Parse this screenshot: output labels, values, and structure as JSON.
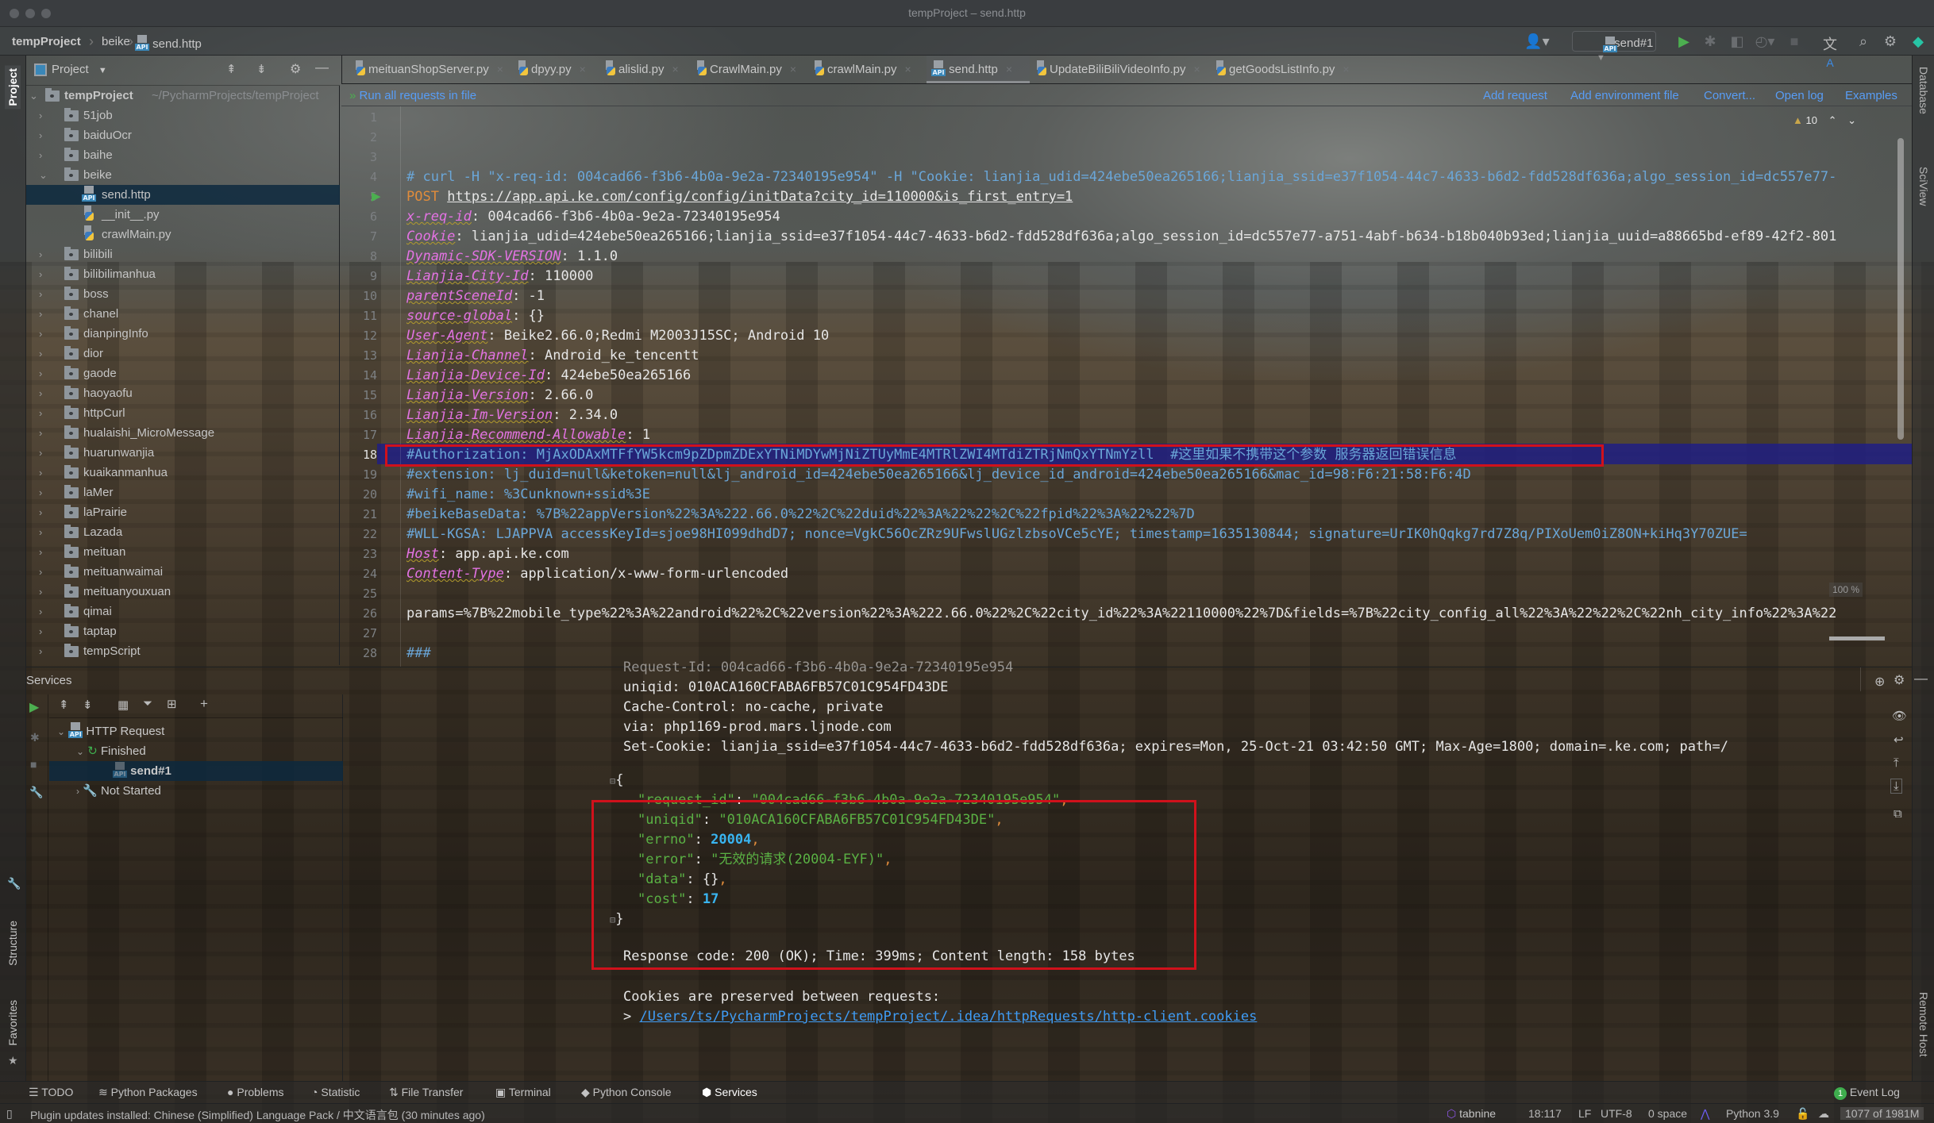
{
  "window": {
    "title": "tempProject – send.http"
  },
  "breadcrumb": {
    "items": [
      "tempProject",
      "beike",
      "send.http"
    ]
  },
  "toolbar": {
    "run_config": "send#1",
    "icons": [
      "vcs-user-icon",
      "run-icon",
      "debug-icon",
      "coverage-icon",
      "profile-icon",
      "stop-icon",
      "translate-icon",
      "search-icon",
      "settings-icon",
      "toolbox-icon"
    ]
  },
  "project_panel": {
    "title": "Project",
    "root": {
      "name": "tempProject",
      "path": "~/PycharmProjects/tempProject"
    },
    "items": [
      {
        "name": "51job",
        "type": "folder",
        "expanded": false
      },
      {
        "name": "baiduOcr",
        "type": "folder",
        "expanded": false
      },
      {
        "name": "baihe",
        "type": "folder",
        "expanded": false
      },
      {
        "name": "beike",
        "type": "folder",
        "expanded": true
      },
      {
        "name": "send.http",
        "type": "http",
        "child": true,
        "selected": true
      },
      {
        "name": "__init__.py",
        "type": "py",
        "child": true
      },
      {
        "name": "crawlMain.py",
        "type": "py",
        "child": true
      },
      {
        "name": "bilibili",
        "type": "folder"
      },
      {
        "name": "bilibilimanhua",
        "type": "folder"
      },
      {
        "name": "boss",
        "type": "folder"
      },
      {
        "name": "chanel",
        "type": "folder"
      },
      {
        "name": "dianpingInfo",
        "type": "folder"
      },
      {
        "name": "dior",
        "type": "folder"
      },
      {
        "name": "gaode",
        "type": "folder"
      },
      {
        "name": "haoyaofu",
        "type": "folder"
      },
      {
        "name": "httpCurl",
        "type": "folder"
      },
      {
        "name": "hualaishi_MicroMessage",
        "type": "folder"
      },
      {
        "name": "huarunwanjia",
        "type": "folder"
      },
      {
        "name": "kuaikanmanhua",
        "type": "folder"
      },
      {
        "name": "laMer",
        "type": "folder"
      },
      {
        "name": "laPrairie",
        "type": "folder"
      },
      {
        "name": "Lazada",
        "type": "folder"
      },
      {
        "name": "meituan",
        "type": "folder"
      },
      {
        "name": "meituanwaimai",
        "type": "folder"
      },
      {
        "name": "meituanyouxuan",
        "type": "folder"
      },
      {
        "name": "qimai",
        "type": "folder"
      },
      {
        "name": "taptap",
        "type": "folder"
      },
      {
        "name": "tempScript",
        "type": "folder"
      }
    ]
  },
  "tabs": [
    {
      "label": "meituanShopServer.py",
      "type": "py"
    },
    {
      "label": "dpyy.py",
      "type": "py"
    },
    {
      "label": "alislid.py",
      "type": "py"
    },
    {
      "label": "CrawlMain.py",
      "type": "py"
    },
    {
      "label": "crawlMain.py",
      "type": "py"
    },
    {
      "label": "send.http",
      "type": "http",
      "active": true
    },
    {
      "label": "UpdateBiliBiliVideoInfo.py",
      "type": "py"
    },
    {
      "label": "getGoodsListInfo.py",
      "type": "py"
    }
  ],
  "http_toolbar": {
    "run_all": "Run all requests in file",
    "links": [
      "Add request",
      "Add environment file",
      "Convert...",
      "Open log",
      "Examples"
    ]
  },
  "inspections": {
    "warnings": "10"
  },
  "editor": {
    "current_line": 18,
    "lines": [
      {
        "n": 1,
        "parts": []
      },
      {
        "n": 2,
        "parts": []
      },
      {
        "n": 3,
        "parts": []
      },
      {
        "n": 4,
        "parts": [
          {
            "c": "cm",
            "t": "# curl -H \"x-req-id: 004cad66-f3b6-4b0a-9e2a-72340195e954\" -H \"Cookie: lianjia_udid=424ebe50ea265166;lianjia_ssid=e37f1054-44c7-4633-b6d2-fdd528df636a;algo_session_id=dc557e77-"
          }
        ]
      },
      {
        "n": 5,
        "parts": [
          {
            "c": "post",
            "t": "POST"
          },
          {
            "c": "",
            "t": " "
          },
          {
            "c": "url",
            "t": "https://app.api.ke.com/config/config/initData?city_id=110000&is_first_entry=1"
          }
        ]
      },
      {
        "n": 6,
        "parts": [
          {
            "c": "k",
            "t": "x-req-id"
          },
          {
            "c": "",
            "t": ": 004cad66-f3b6-4b0a-9e2a-72340195e954"
          }
        ]
      },
      {
        "n": 7,
        "parts": [
          {
            "c": "k",
            "t": "Cookie"
          },
          {
            "c": "",
            "t": ": lianjia_udid=424ebe50ea265166;lianjia_ssid=e37f1054-44c7-4633-b6d2-fdd528df636a;algo_session_id=dc557e77-a751-4abf-b634-b18b040b93ed;lianjia_uuid=a88665bd-ef89-42f2-801"
          }
        ]
      },
      {
        "n": 8,
        "parts": [
          {
            "c": "k",
            "t": "Dynamic-SDK-VERSION"
          },
          {
            "c": "",
            "t": ": 1.1.0"
          }
        ]
      },
      {
        "n": 9,
        "parts": [
          {
            "c": "k",
            "t": "Lianjia-City-Id"
          },
          {
            "c": "",
            "t": ": 110000"
          }
        ]
      },
      {
        "n": 10,
        "parts": [
          {
            "c": "k",
            "t": "parentSceneId"
          },
          {
            "c": "",
            "t": ": -1"
          }
        ]
      },
      {
        "n": 11,
        "parts": [
          {
            "c": "k",
            "t": "source-global"
          },
          {
            "c": "",
            "t": ": {}"
          }
        ]
      },
      {
        "n": 12,
        "parts": [
          {
            "c": "k",
            "t": "User-Agent"
          },
          {
            "c": "",
            "t": ": Beike2.66.0;Redmi M2003J15SC; Android 10"
          }
        ]
      },
      {
        "n": 13,
        "parts": [
          {
            "c": "k",
            "t": "Lianjia-Channel"
          },
          {
            "c": "",
            "t": ": Android_ke_tencentt"
          }
        ]
      },
      {
        "n": 14,
        "parts": [
          {
            "c": "k",
            "t": "Lianjia-Device-Id"
          },
          {
            "c": "",
            "t": ": 424ebe50ea265166"
          }
        ]
      },
      {
        "n": 15,
        "parts": [
          {
            "c": "k",
            "t": "Lianjia-Version"
          },
          {
            "c": "",
            "t": ": 2.66.0"
          }
        ]
      },
      {
        "n": 16,
        "parts": [
          {
            "c": "k",
            "t": "Lianjia-Im-Version"
          },
          {
            "c": "",
            "t": ": 2.34.0"
          }
        ]
      },
      {
        "n": 17,
        "parts": [
          {
            "c": "k",
            "t": "Lianjia-Recommend-Allowable"
          },
          {
            "c": "",
            "t": ": 1"
          }
        ]
      },
      {
        "n": 18,
        "parts": [
          {
            "c": "cm",
            "t": "#Authorization: MjAxODAxMTFfYW5kcm9pZDpmZDExYTNiMDYwMjNiZTUyMmE4MTRlZWI4MTdiZTRjNmQxYTNmYzll  #这里如果不携带这个参数 服务器返回错误信息"
          }
        ]
      },
      {
        "n": 19,
        "parts": [
          {
            "c": "cm",
            "t": "#extension: lj_duid=null&ketoken=null&lj_android_id=424ebe50ea265166&lj_device_id_android=424ebe50ea265166&mac_id=98:F6:21:58:F6:4D"
          }
        ]
      },
      {
        "n": 20,
        "parts": [
          {
            "c": "cm",
            "t": "#wifi_name: %3Cunknown+ssid%3E"
          }
        ]
      },
      {
        "n": 21,
        "parts": [
          {
            "c": "cm",
            "t": "#beikeBaseData: %7B%22appVersion%22%3A%222.66.0%22%2C%22duid%22%3A%22%22%2C%22fpid%22%3A%22%22%7D"
          }
        ]
      },
      {
        "n": 22,
        "parts": [
          {
            "c": "cm",
            "t": "#WLL-KGSA: LJAPPVA accessKeyId=sjoe98HI099dhdD7; nonce=VgkC56OcZRz9UFwslUGzlzbsoVCe5cYE; timestamp=1635130844; signature=UrIK0hQqkg7rd7Z8q/PIXoUem0iZ8ON+kiHq3Y70ZUE="
          }
        ]
      },
      {
        "n": 23,
        "parts": [
          {
            "c": "k",
            "t": "Host"
          },
          {
            "c": "",
            "t": ": app.api.ke.com"
          }
        ]
      },
      {
        "n": 24,
        "parts": [
          {
            "c": "k",
            "t": "Content-Type"
          },
          {
            "c": "",
            "t": ": application/x-www-form-urlencoded"
          }
        ]
      },
      {
        "n": 25,
        "parts": []
      },
      {
        "n": 26,
        "parts": [
          {
            "c": "",
            "t": "params=%7B%22mobile_type%22%3A%22android%22%2C%22version%22%3A%222.66.0%22%2C%22city_id%22%3A%22110000%22%7D&fields=%7B%22city_config_all%22%3A%22%22%2C%22nh_city_info%22%3A%22"
          }
        ]
      },
      {
        "n": 27,
        "parts": []
      },
      {
        "n": 28,
        "parts": [
          {
            "c": "cm",
            "t": "###"
          }
        ]
      }
    ],
    "zoom_label": "100 %"
  },
  "services": {
    "title": "Services",
    "tree": [
      {
        "label": "HTTP Request",
        "level": 0,
        "icon": "api-icon",
        "expanded": true
      },
      {
        "label": "Finished",
        "level": 1,
        "icon": "finished-icon",
        "expanded": true
      },
      {
        "label": "send#1",
        "level": 2,
        "icon": "api-icon",
        "selected": true
      },
      {
        "label": "Not Started",
        "level": 1,
        "icon": "wrench-icon",
        "expanded": false
      }
    ],
    "output": {
      "headers": [
        "Request-Id: 004cad66-f3b6-4b0a-9e2a-72340195e954",
        "uniqid: 010ACA160CFABA6FB57C01C954FD43DE",
        "Cache-Control: no-cache, private",
        "via: php1169-prod.mars.ljnode.com",
        "Set-Cookie: lianjia_ssid=e37f1054-44c7-4633-b6d2-fdd528df636a; expires=Mon, 25-Oct-21 03:42:50 GMT; Max-Age=1800; domain=.ke.com; path=/"
      ],
      "json": [
        {
          "key": "\"request_id\"",
          "val": "\"004cad66-f3b6-4b0a-9e2a-72340195e954\"",
          "type": "str",
          "comma": true
        },
        {
          "key": "\"uniqid\"",
          "val": "\"010ACA160CFABA6FB57C01C954FD43DE\"",
          "type": "str",
          "comma": true
        },
        {
          "key": "\"errno\"",
          "val": "20004",
          "type": "num",
          "comma": true
        },
        {
          "key": "\"error\"",
          "val": "\"无效的请求(20004-EYF)\"",
          "type": "str",
          "comma": true
        },
        {
          "key": "\"data\"",
          "val": "{}",
          "type": "obj",
          "comma": true
        },
        {
          "key": "\"cost\"",
          "val": "17",
          "type": "num",
          "comma": false
        }
      ],
      "summary": "Response code: 200 (OK); Time: 399ms; Content length: 158 bytes",
      "cookies_note": "Cookies are preserved between requests:",
      "cookies_path": "/Users/ts/PycharmProjects/tempProject/.idea/httpRequests/http-client.cookies"
    }
  },
  "left_stripe": {
    "top": "Project",
    "bottom": [
      "Structure",
      "Favorites"
    ]
  },
  "right_stripe": {
    "top": [
      "Database",
      "SciView"
    ],
    "bottom": "Remote Host"
  },
  "tool_windows": [
    {
      "label": "TODO",
      "icon": "list-icon"
    },
    {
      "label": "Python Packages",
      "icon": "layers-icon"
    },
    {
      "label": "Problems",
      "icon": "problems-icon"
    },
    {
      "label": "Statistic",
      "icon": "statistic-icon"
    },
    {
      "label": "File Transfer",
      "icon": "transfer-icon"
    },
    {
      "label": "Terminal",
      "icon": "terminal-icon"
    },
    {
      "label": "Python Console",
      "icon": "python-icon"
    },
    {
      "label": "Services",
      "icon": "services-icon",
      "active": true
    }
  ],
  "event_log": {
    "count": "1",
    "label": "Event Log"
  },
  "status_bar": {
    "message": "Plugin updates installed: Chinese (Simplified) Language Pack / 中文语言包 (30 minutes ago)",
    "tabnine": "tabnine",
    "position": "18:117",
    "line_sep": "LF",
    "encoding": "UTF-8",
    "indent": "0 space",
    "interpreter": "Python 3.9",
    "memory": "1077 of 1981M"
  },
  "colors": {
    "accent_link": "#589df6",
    "run_green": "#4caf50",
    "highlight_red": "#d0111b",
    "keyword_pink": "#e373e3",
    "comment_blue": "#6aa6d8"
  }
}
